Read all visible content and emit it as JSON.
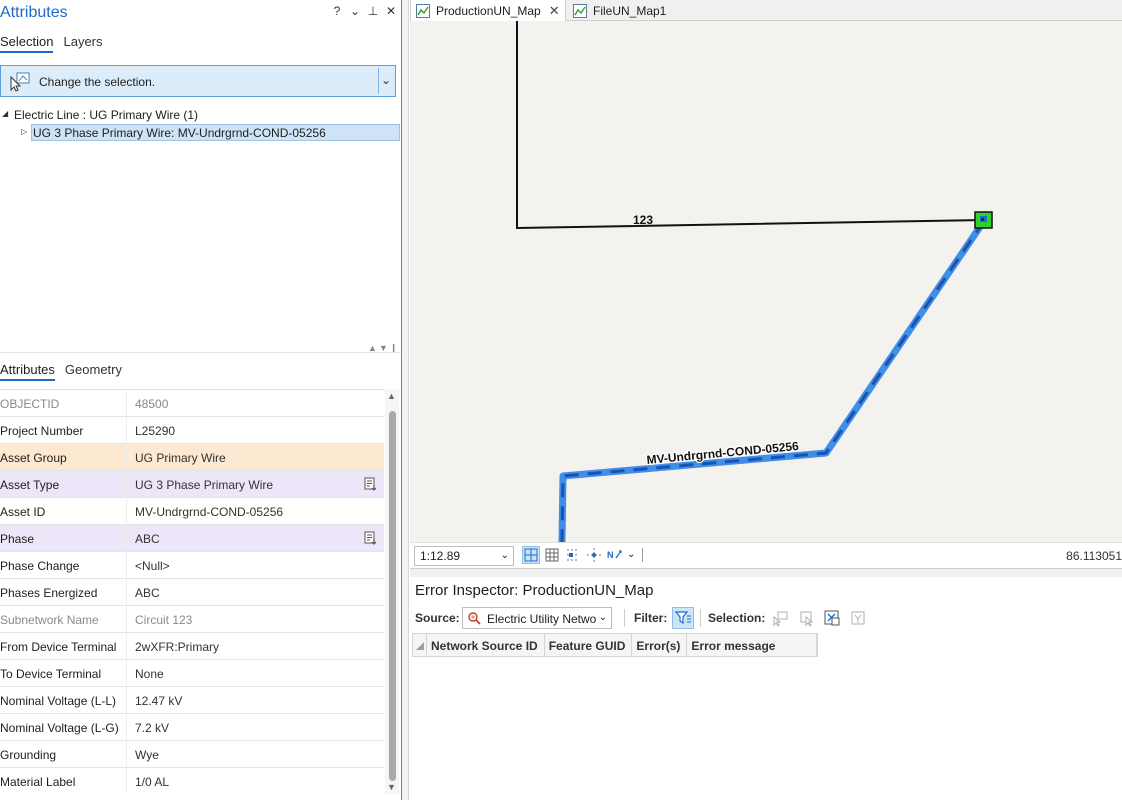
{
  "attributes_pane": {
    "title": "Attributes",
    "controls": {
      "help": "?",
      "menu": "⌄",
      "pin": "⊥",
      "close": "✕"
    },
    "top_tabs": [
      {
        "label": "Selection",
        "active": true
      },
      {
        "label": "Layers",
        "active": false
      }
    ],
    "change_selection": {
      "label": "Change the selection.",
      "icon": "change-selection-icon"
    },
    "tree": {
      "parent": "Electric Line : UG Primary Wire (1)",
      "child": "UG 3 Phase Primary Wire: MV-Undrgrnd-COND-05256"
    },
    "bottom_tabs": [
      {
        "label": "Attributes",
        "active": true
      },
      {
        "label": "Geometry",
        "active": false
      }
    ],
    "fields": [
      {
        "name": "OBJECTID",
        "value": "48500",
        "readonly": true,
        "highlight": ""
      },
      {
        "name": "Project Number",
        "value": "L25290",
        "readonly": false,
        "highlight": ""
      },
      {
        "name": "Asset Group",
        "value": "UG Primary Wire",
        "readonly": false,
        "highlight": "orange"
      },
      {
        "name": "Asset Type",
        "value": "UG 3 Phase Primary Wire",
        "readonly": false,
        "highlight": "purple",
        "edit_icon": true
      },
      {
        "name": "Asset ID",
        "value": "MV-Undrgrnd-COND-05256",
        "readonly": false,
        "highlight": ""
      },
      {
        "name": "Phase",
        "value": "ABC",
        "readonly": false,
        "highlight": "purple",
        "edit_icon": true
      },
      {
        "name": "Phase Change",
        "value": "<Null>",
        "readonly": false,
        "highlight": ""
      },
      {
        "name": "Phases Energized",
        "value": "ABC",
        "readonly": false,
        "highlight": ""
      },
      {
        "name": "Subnetwork Name",
        "value": "Circuit 123",
        "readonly": true,
        "highlight": ""
      },
      {
        "name": "From Device Terminal",
        "value": "2wXFR:Primary",
        "readonly": false,
        "highlight": ""
      },
      {
        "name": "To Device Terminal",
        "value": "None",
        "readonly": false,
        "highlight": ""
      },
      {
        "name": "Nominal Voltage (L-L)",
        "value": "12.47 kV",
        "readonly": false,
        "highlight": ""
      },
      {
        "name": "Nominal Voltage (L-G)",
        "value": "7.2 kV",
        "readonly": false,
        "highlight": ""
      },
      {
        "name": "Grounding",
        "value": "Wye",
        "readonly": false,
        "highlight": ""
      },
      {
        "name": "Material Label",
        "value": "1/0 AL",
        "readonly": false,
        "highlight": ""
      }
    ]
  },
  "doc_tabs": [
    {
      "label": "ProductionUN_Map",
      "active": true
    },
    {
      "label": "FileUN_Map1",
      "active": false
    }
  ],
  "map": {
    "labels": {
      "line_label": "123",
      "wire_label": "MV-Undrgrnd-COND-05256"
    },
    "colors": {
      "background": "#f3f2ee",
      "selected_line": "#3d8fe8",
      "selected_dash": "#1f4fb0",
      "device": "#2fd12f"
    }
  },
  "map_status": {
    "scale": "1:12.89",
    "coordinate": "86.113051"
  },
  "error_inspector": {
    "title": "Error Inspector: ProductionUN_Map",
    "source_label": "Source:",
    "source_value": "Electric Utility Network",
    "filter_label": "Filter:",
    "selection_label": "Selection:",
    "columns": [
      "Network Source ID",
      "Feature GUID",
      "Error(s)",
      "Error message"
    ]
  }
}
